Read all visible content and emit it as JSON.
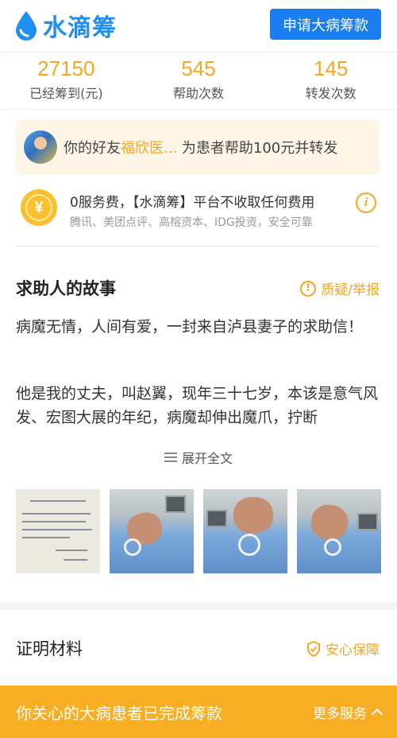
{
  "header": {
    "logo_text": "水滴筹",
    "apply_button": "申请大病筹款"
  },
  "stats": [
    {
      "value": "27150",
      "label": "已经筹到(元)"
    },
    {
      "value": "545",
      "label": "帮助次数"
    },
    {
      "value": "145",
      "label": "转发次数"
    }
  ],
  "friend_banner": {
    "prefix": "你的好友",
    "name": "福欣医...",
    "suffix": " 为患者帮助100元并转发"
  },
  "fee_notice": {
    "title": "0服务费，【水滴筹】平台不收取任何费用",
    "subtitle": "腾讯、美团点评、高榕资本、IDG投资，安全可靠",
    "coin_symbol": "¥",
    "info_symbol": "i"
  },
  "story": {
    "title": "求助人的故事",
    "report_label": "质疑/举报",
    "paragraph1": "病魔无情，人间有爱，一封来自泸县妻子的求助信！",
    "paragraph2": "他是我的丈夫，叫赵翼，现年三十七岁，本该是意气风发、宏图大展的年纪，病魔却伸出魔爪，拧断",
    "expand_label": "展开全文"
  },
  "proof": {
    "title": "证明材料",
    "safe_label": "安心保障"
  },
  "bottom_bar": {
    "text": "你关心的大病患者已完成筹款",
    "more_label": "更多服务"
  },
  "colors": {
    "brand_blue": "#1a7ef0",
    "accent_orange": "#f6a623",
    "bottom_bar": "#f7ae22"
  }
}
